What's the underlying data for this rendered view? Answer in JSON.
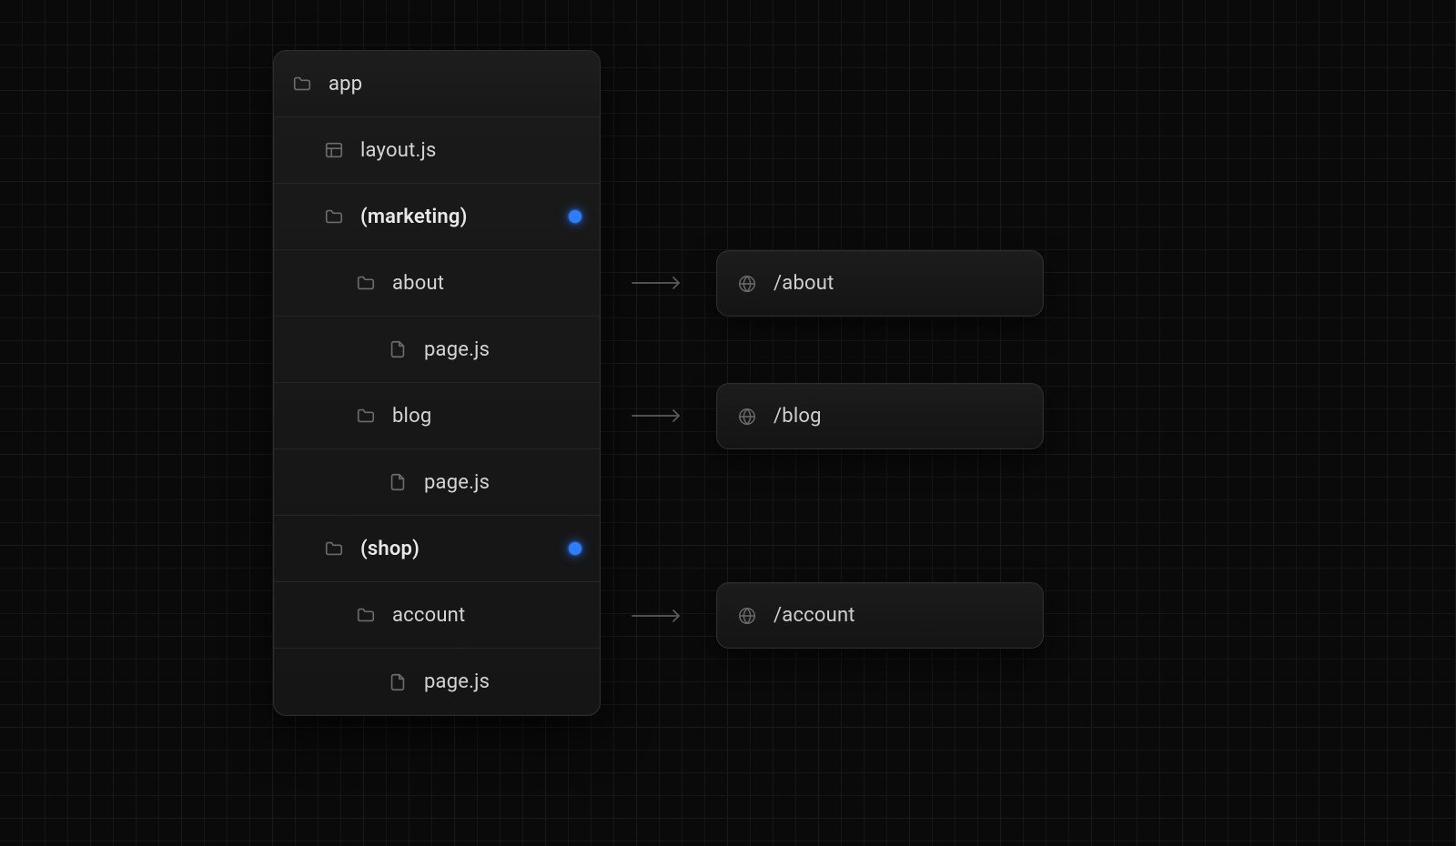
{
  "tree": {
    "root": "app",
    "rows": [
      {
        "label": "layout.js",
        "icon": "layout",
        "depth": 1,
        "group": false,
        "dot": false
      },
      {
        "label": "(marketing)",
        "icon": "folder",
        "depth": 1,
        "group": true,
        "dot": true
      },
      {
        "label": "about",
        "icon": "folder",
        "depth": 2,
        "group": false,
        "dot": false
      },
      {
        "label": "page.js",
        "icon": "file",
        "depth": 3,
        "group": false,
        "dot": false
      },
      {
        "label": "blog",
        "icon": "folder",
        "depth": 2,
        "group": false,
        "dot": false
      },
      {
        "label": "page.js",
        "icon": "file",
        "depth": 3,
        "group": false,
        "dot": false
      },
      {
        "label": "(shop)",
        "icon": "folder",
        "depth": 1,
        "group": true,
        "dot": true
      },
      {
        "label": "account",
        "icon": "folder",
        "depth": 2,
        "group": false,
        "dot": false
      },
      {
        "label": "page.js",
        "icon": "file",
        "depth": 3,
        "group": false,
        "dot": false
      }
    ]
  },
  "routes": [
    "/about",
    "/blog",
    "/account"
  ],
  "colors": {
    "indicator": "#2f7dff",
    "panel_border": "#2e2e2e",
    "text": "#d4d4d4",
    "icon": "#6b6b6b"
  }
}
